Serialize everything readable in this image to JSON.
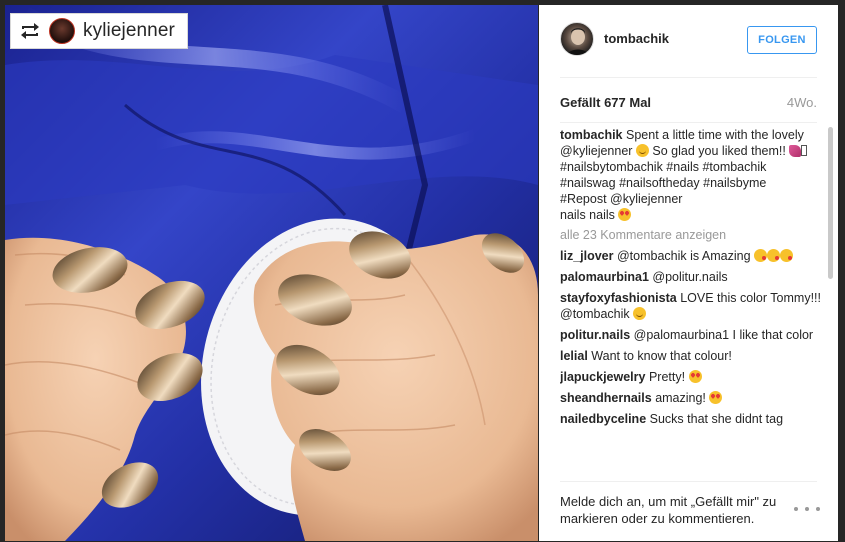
{
  "repost": {
    "username": "kyliejenner",
    "icon": "repost-icon"
  },
  "post": {
    "author": "tombachik",
    "follow_label": "FOLGEN",
    "likes": "Gefällt 677 Mal",
    "age": "4Wo.",
    "caption": {
      "username": "tombachik",
      "lines": [
        "Spent a little time with the lovely @kyliejenner",
        "So glad you liked them!!",
        "#nailsbytombachik #nails #tombachik #nailswag #nailsoftheday #nailsbyme",
        "#Repost @kyliejenner",
        "nails nails"
      ]
    },
    "view_all_comments": "alle 23 Kommentare anzeigen",
    "comments": [
      {
        "username": "liz_jlover",
        "text": "@tombachik is Amazing"
      },
      {
        "username": "palomaurbina1",
        "text": "@politur.nails"
      },
      {
        "username": "stayfoxyfashionista",
        "text": "LOVE this color Tommy!!! @tombachik"
      },
      {
        "username": "politur.nails",
        "text": "@palomaurbina1 I like that color"
      },
      {
        "username": "lelial",
        "text": "Want to know that colour!"
      },
      {
        "username": "jlapuckjewelry",
        "text": "Pretty!"
      },
      {
        "username": "sheandhernails",
        "text": "amazing!"
      },
      {
        "username": "nailedbyceline",
        "text": "Sucks that she didnt tag"
      }
    ],
    "login_prompt": "Melde dich an, um mit „Gefällt mir\" zu markieren oder zu kommentieren.",
    "more_icon": "more-options-icon"
  },
  "colors": {
    "link_blue": "#3897f0",
    "text_dark": "#262626",
    "text_muted": "#999999",
    "jacket_blue": "#2a35a8"
  }
}
